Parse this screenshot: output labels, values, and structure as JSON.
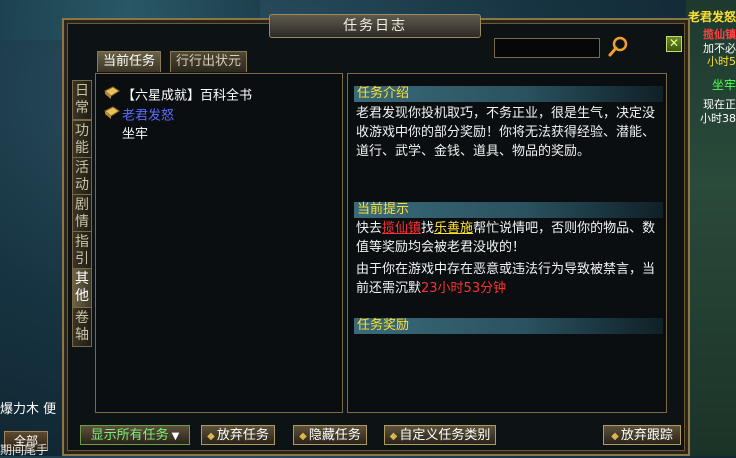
{
  "window": {
    "title": "任务日志",
    "close_label": "✕"
  },
  "tabs": [
    {
      "label": "当前任务"
    },
    {
      "label": "行行出状元"
    }
  ],
  "side_tabs": [
    {
      "label": "日常"
    },
    {
      "label": "功能"
    },
    {
      "label": "活动"
    },
    {
      "label": "剧情"
    },
    {
      "label": "指引"
    },
    {
      "label": "其他"
    },
    {
      "label": "卷轴"
    }
  ],
  "quest_list": [
    {
      "label": "【六星成就】百科全书",
      "icon": "scroll-icon"
    },
    {
      "label": "老君发怒",
      "icon": "scroll-icon"
    },
    {
      "label": "坐牢",
      "icon": "none"
    }
  ],
  "detail": {
    "intro_header": "任务介绍",
    "intro_text": "老君发现你投机取巧，不务正业，很是生气，决定没收游戏中你的部分奖励！你将无法获得经验、潜能、道行、武学、金钱、道具、物品的奖励。",
    "tip_header": "当前提示",
    "tip_prefix": "快去",
    "tip_place": "揽仙镇",
    "tip_mid": "找",
    "tip_npc": "乐善施",
    "tip_suffix": "帮忙说情吧，否则你的物品、数值等奖励均会被老君没收的！",
    "ban_text": "由于你在游戏中存在恶意或违法行为导致被禁言，当前还需沉默",
    "ban_time": "23小时53分钟",
    "reward_header": "任务奖励"
  },
  "bottom": {
    "filter_label": "显示所有任务",
    "abandon_label": "放弃任务",
    "hide_label": "隐藏任务",
    "custom_label": "自定义任务类别",
    "untrack_label": "放弃跟踪"
  },
  "background": {
    "right_texts": [
      "老君发怒",
      "揽仙镇",
      "加不必",
      "小时5",
      "坐牢",
      "现在正",
      "小时38"
    ],
    "left_text": "爆力木  便",
    "all_button": "全部",
    "left_bottom_text": "期间尾手"
  },
  "colors": {
    "highlight_yellow": "#ffe030",
    "link_red": "#ff3030",
    "selected_blue": "#5a6cff",
    "filter_green": "#7cf07c"
  }
}
